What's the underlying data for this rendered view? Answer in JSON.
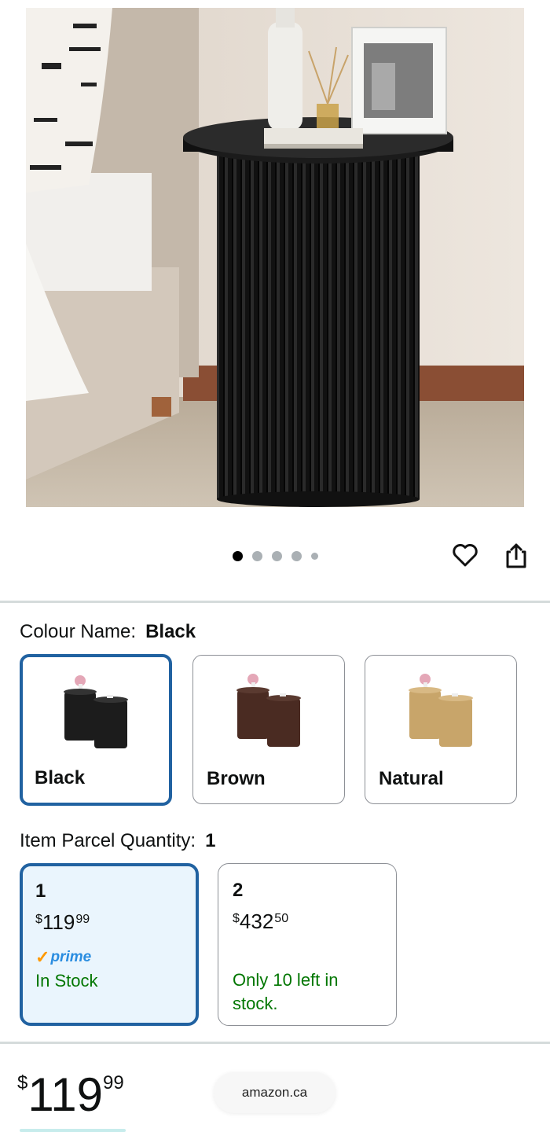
{
  "gallery": {
    "image_count": 5,
    "active_index": 0
  },
  "actions": {
    "wishlist_icon": "heart-icon",
    "share_icon": "share-icon"
  },
  "colour": {
    "label": "Colour Name:",
    "selected": "Black",
    "options": [
      {
        "name": "Black",
        "color": "#1c1c1c"
      },
      {
        "name": "Brown",
        "color": "#4a2b22"
      },
      {
        "name": "Natural",
        "color": "#c8a56a"
      }
    ]
  },
  "quantity": {
    "label": "Item Parcel Quantity:",
    "selected": "1",
    "options": [
      {
        "qty": "1",
        "currency": "$",
        "dollars": "119",
        "cents": "99",
        "prime": "prime",
        "stock_line1": "In Stock",
        "stock_line2": ""
      },
      {
        "qty": "2",
        "currency": "$",
        "dollars": "432",
        "cents": "50",
        "prime": "",
        "stock_line1": "Only 10 left in",
        "stock_line2": "stock."
      }
    ]
  },
  "price": {
    "currency": "$",
    "dollars": "119",
    "cents": "99"
  },
  "browser": {
    "domain": "amazon.ca"
  },
  "colors": {
    "selected_border": "#2162a1",
    "selected_bg": "#eaf5fd",
    "in_stock": "#007600",
    "prime_blue": "#2a8de0",
    "prime_check": "#ff9900"
  }
}
